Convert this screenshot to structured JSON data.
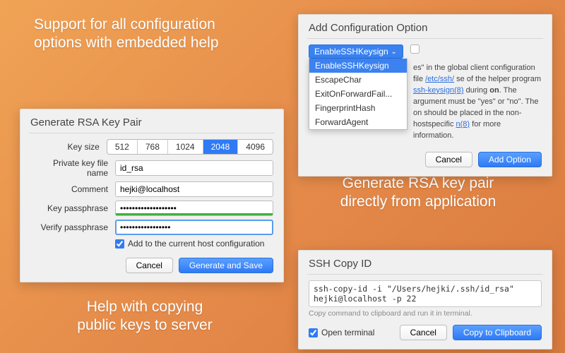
{
  "promos": {
    "topLeft": "Support for all configuration\noptions with embedded help",
    "midRight": "Generate RSA key pair\ndirectly from application",
    "bottomLeft": "Help with copying\npublic keys to server"
  },
  "rsa": {
    "title": "Generate RSA Key Pair",
    "labels": {
      "keySize": "Key size",
      "fileName": "Private key file name",
      "comment": "Comment",
      "passphrase": "Key passphrase",
      "verify": "Verify passphrase"
    },
    "sizes": [
      "512",
      "768",
      "1024",
      "2048",
      "4096"
    ],
    "fileName": "id_rsa",
    "comment": "hejki@localhost",
    "passphrase": "•••••••••••••••••••",
    "verify": "•••••••••••••••••",
    "addHost": "Add to the current host configuration",
    "cancel": "Cancel",
    "generate": "Generate and Save"
  },
  "config": {
    "title": "Add Configuration Option",
    "selected": "EnableSSHKeysign",
    "options": [
      "EnableSSHKeysign",
      "EscapeChar",
      "ExitOnForwardFail...",
      "FingerprintHash",
      "ForwardAgent"
    ],
    "help_pre": "es\" in the global client configuration file ",
    "help_link1": "/etc/ssh/",
    "help_mid1": " se of the helper program ",
    "help_link2": "ssh-keysign(8)",
    "help_mid2": " during ",
    "help_bold": "on",
    "help_mid3": ". The argument must be \"yes\" or \"no\". The on should be placed in the non-hostspecific ",
    "help_link3": "n(8)",
    "help_post": " for more information.",
    "cancel": "Cancel",
    "add": "Add Option"
  },
  "copyid": {
    "title": "SSH Copy ID",
    "command": "ssh-copy-id -i \"/Users/hejki/.ssh/id_rsa\" hejki@localhost -p 22",
    "hint": "Copy command to clipboard and run it in terminal.",
    "openTerminal": "Open terminal",
    "cancel": "Cancel",
    "copy": "Copy to Clipboard"
  }
}
